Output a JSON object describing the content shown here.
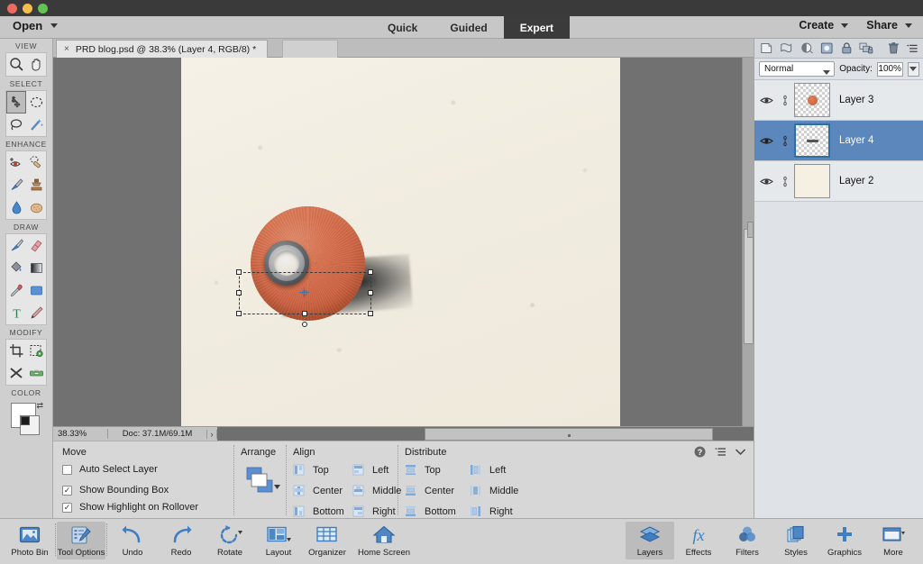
{
  "window": {
    "traffic_lights": [
      "close",
      "minimize",
      "maximize"
    ]
  },
  "menubar": {
    "open_label": "Open",
    "modes": [
      {
        "label": "Quick",
        "active": false
      },
      {
        "label": "Guided",
        "active": false
      },
      {
        "label": "Expert",
        "active": true
      }
    ],
    "create_label": "Create",
    "share_label": "Share"
  },
  "document_tab": {
    "close_glyph": "×",
    "title": "PRD blog.psd @ 38.3% (Layer 4, RGB/8) *"
  },
  "toolbox": {
    "sections": [
      {
        "heading": "VIEW",
        "tools": [
          {
            "name": "zoom-tool",
            "selected": false
          },
          {
            "name": "hand-tool",
            "selected": false
          }
        ]
      },
      {
        "heading": "SELECT",
        "tools": [
          {
            "name": "move-tool",
            "selected": true
          },
          {
            "name": "marquee-select-tool",
            "selected": false
          },
          {
            "name": "lasso-tool",
            "selected": false
          },
          {
            "name": "magic-wand-tool",
            "selected": false
          }
        ]
      },
      {
        "heading": "ENHANCE",
        "tools": [
          {
            "name": "red-eye-removal-tool",
            "selected": false
          },
          {
            "name": "spot-healing-brush-tool",
            "selected": false
          },
          {
            "name": "smart-brush-tool",
            "selected": false
          },
          {
            "name": "clone-stamp-tool",
            "selected": false
          },
          {
            "name": "blur-tool",
            "selected": false
          },
          {
            "name": "sponge-tool",
            "selected": false
          }
        ]
      },
      {
        "heading": "DRAW",
        "tools": [
          {
            "name": "brush-tool",
            "selected": false
          },
          {
            "name": "eraser-tool",
            "selected": false
          },
          {
            "name": "paint-bucket-tool",
            "selected": false
          },
          {
            "name": "gradient-tool",
            "selected": false
          },
          {
            "name": "eyedropper-tool",
            "selected": false
          },
          {
            "name": "shape-tool",
            "selected": false
          },
          {
            "name": "type-tool",
            "selected": false
          },
          {
            "name": "pencil-tool",
            "selected": false
          }
        ]
      },
      {
        "heading": "MODIFY",
        "tools": [
          {
            "name": "crop-tool",
            "selected": false
          },
          {
            "name": "content-aware-move-tool",
            "selected": false
          },
          {
            "name": "recompose-tool",
            "selected": false
          },
          {
            "name": "straighten-tool",
            "selected": false
          }
        ]
      },
      {
        "heading": "COLOR",
        "tools": []
      }
    ]
  },
  "statusbar": {
    "zoom": "38.33%",
    "doc_info": "Doc: 37.1M/69.1M",
    "expand_glyph": "›"
  },
  "tool_options": {
    "title": "Move",
    "checkboxes": [
      {
        "label": "Auto Select Layer",
        "checked": false
      },
      {
        "label": "Show Bounding Box",
        "checked": true
      },
      {
        "label": "Show Highlight on Rollover",
        "checked": true
      }
    ],
    "arrange": {
      "label": "Arrange"
    },
    "align": {
      "label": "Align",
      "col1": [
        "Top",
        "Center",
        "Bottom"
      ],
      "col2": [
        "Left",
        "Middle",
        "Right"
      ]
    },
    "distribute": {
      "label": "Distribute",
      "col1": [
        "Top",
        "Center",
        "Bottom"
      ],
      "col2": [
        "Left",
        "Middle",
        "Right"
      ]
    },
    "right_icons": [
      "help-icon",
      "panel-menu-icon",
      "collapse-chevron-icon"
    ]
  },
  "layers_panel": {
    "toolbar_icons": [
      "add-layer-icon",
      "add-layer-mask-icon",
      "adjustment-layer-icon",
      "layer-mask-icon",
      "lock-icon",
      "link-layers-icon",
      "delete-layer-icon",
      "panel-menu-icon"
    ],
    "blend_mode": "Normal",
    "opacity_label": "Opacity:",
    "opacity_value": "100%",
    "layers": [
      {
        "name": "Layer 3",
        "visible": true,
        "selected": false,
        "thumb": "dot"
      },
      {
        "name": "Layer 4",
        "visible": true,
        "selected": true,
        "thumb": "dash"
      },
      {
        "name": "Layer 2",
        "visible": true,
        "selected": false,
        "thumb": "paper"
      }
    ]
  },
  "taskbar": {
    "left_items": [
      {
        "label": "Photo Bin",
        "icon": "photo-bin-icon",
        "active": false
      },
      {
        "label": "Tool Options",
        "icon": "tool-options-icon",
        "active": true
      },
      {
        "label": "Undo",
        "icon": "undo-icon",
        "active": false
      },
      {
        "label": "Redo",
        "icon": "redo-icon",
        "active": false
      },
      {
        "label": "Rotate",
        "icon": "rotate-icon",
        "active": false
      },
      {
        "label": "Layout",
        "icon": "layout-icon",
        "active": false
      },
      {
        "label": "Organizer",
        "icon": "organizer-icon",
        "active": false
      },
      {
        "label": "Home Screen",
        "icon": "home-screen-icon",
        "active": false
      }
    ],
    "right_items": [
      {
        "label": "Layers",
        "icon": "layers-icon",
        "active": true
      },
      {
        "label": "Effects",
        "icon": "effects-icon",
        "active": false
      },
      {
        "label": "Filters",
        "icon": "filters-icon",
        "active": false
      },
      {
        "label": "Styles",
        "icon": "styles-icon",
        "active": false
      },
      {
        "label": "Graphics",
        "icon": "graphics-icon",
        "active": false
      },
      {
        "label": "More",
        "icon": "more-icon",
        "active": false
      }
    ]
  },
  "canvas": {
    "artwork_description": "orange vinyl record disc with drop shadow on cream paper background",
    "selection_active": true
  },
  "colors": {
    "accent_blue": "#5b87bd",
    "disc_orange": "#cf6443",
    "paper": "#f3efe4",
    "canvas_bg": "#717171"
  }
}
